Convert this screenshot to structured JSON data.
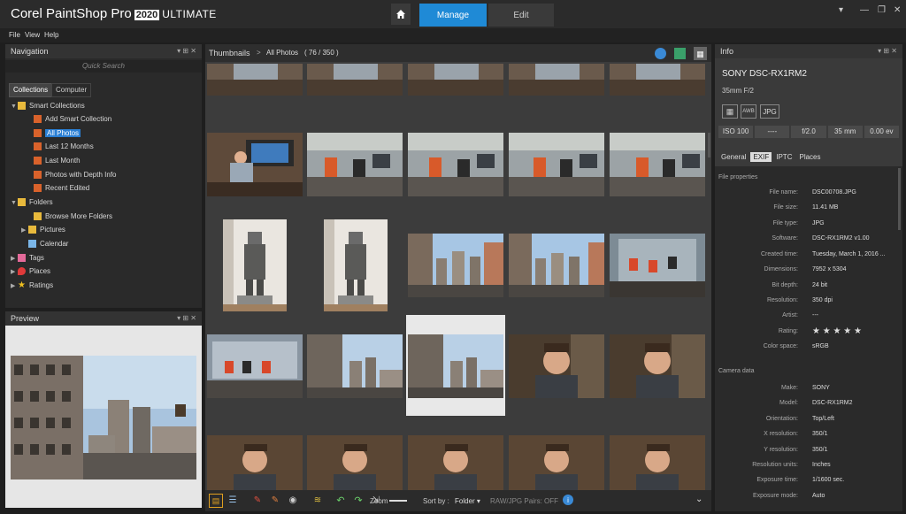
{
  "app": {
    "brand": "Corel PaintShop Pro",
    "version": "2020",
    "edition": "ULTIMATE",
    "tabs": [
      {
        "label": "Manage",
        "active": true
      },
      {
        "label": "Edit",
        "active": false
      }
    ]
  },
  "menu": [
    "File",
    "View",
    "Help"
  ],
  "navigation": {
    "title": "Navigation",
    "search_placeholder": "Quick Search",
    "tabs": [
      "Collections",
      "Computer"
    ],
    "tree": [
      {
        "label": "Smart Collections",
        "icon": "folder-icon"
      },
      {
        "label": "Add Smart Collection",
        "icon": "smart-collection-icon"
      },
      {
        "label": "All Photos",
        "icon": "smart-collection-icon",
        "selected": true
      },
      {
        "label": "Last 12 Months",
        "icon": "smart-collection-icon"
      },
      {
        "label": "Last Month",
        "icon": "smart-collection-icon"
      },
      {
        "label": "Photos with Depth Info",
        "icon": "smart-collection-icon"
      },
      {
        "label": "Recent Edited",
        "icon": "smart-collection-icon"
      },
      {
        "label": "Folders",
        "icon": "folder-icon"
      },
      {
        "label": "Browse More Folders",
        "icon": "folder-icon"
      },
      {
        "label": "Pictures",
        "icon": "folder-icon"
      },
      {
        "label": "Calendar",
        "icon": "calendar-icon"
      },
      {
        "label": "Tags",
        "icon": "tag-icon"
      },
      {
        "label": "Places",
        "icon": "pin-icon"
      },
      {
        "label": "Ratings",
        "icon": "star-icon"
      }
    ]
  },
  "preview": {
    "title": "Preview"
  },
  "thumbnails": {
    "title": "Thumbnails",
    "breadcrumb": "All Photos",
    "count": "( 76 / 350 )",
    "sort_label": "Sort by :",
    "sort_value": "Folder",
    "raw_pairs": "RAW/JPG Pairs: OFF",
    "zoom_label": "Zoom"
  },
  "info": {
    "title": "Info",
    "camera": "SONY DSC-RX1RM2",
    "lens": "35mm F/2",
    "format_badge": "JPG",
    "awb_badge": "AWB",
    "exposure_strip": [
      "ISO 100",
      "----",
      "f/2.0",
      "35 mm",
      "0.00 ev"
    ],
    "tabs": [
      "General",
      "EXIF",
      "IPTC",
      "Places"
    ],
    "file_properties_title": "File properties",
    "file_properties": [
      {
        "k": "File name:",
        "v": "DSC00708.JPG"
      },
      {
        "k": "File size:",
        "v": "11.41 MB"
      },
      {
        "k": "File type:",
        "v": "JPG"
      },
      {
        "k": "Software:",
        "v": "DSC-RX1RM2 v1.00"
      },
      {
        "k": "Created time:",
        "v": "Tuesday, March 1, 2016 ..."
      },
      {
        "k": "Dimensions:",
        "v": "7952 x 5304"
      },
      {
        "k": "Bit depth:",
        "v": "24 bit"
      },
      {
        "k": "Resolution:",
        "v": "350 dpi"
      },
      {
        "k": "Artist:",
        "v": "---"
      },
      {
        "k": "Rating:",
        "v": "★ ★ ★ ★ ★"
      },
      {
        "k": "Color space:",
        "v": "sRGB"
      }
    ],
    "camera_data_title": "Camera data",
    "camera_data": [
      {
        "k": "Make:",
        "v": "SONY"
      },
      {
        "k": "Model:",
        "v": "DSC-RX1RM2"
      },
      {
        "k": "Orientation:",
        "v": "Top/Left"
      },
      {
        "k": "X resolution:",
        "v": "350/1"
      },
      {
        "k": "Y resolution:",
        "v": "350/1"
      },
      {
        "k": "Resolution units:",
        "v": "Inches"
      },
      {
        "k": "Exposure time:",
        "v": "1/1600 sec."
      },
      {
        "k": "Exposure mode:",
        "v": "Auto"
      }
    ]
  }
}
